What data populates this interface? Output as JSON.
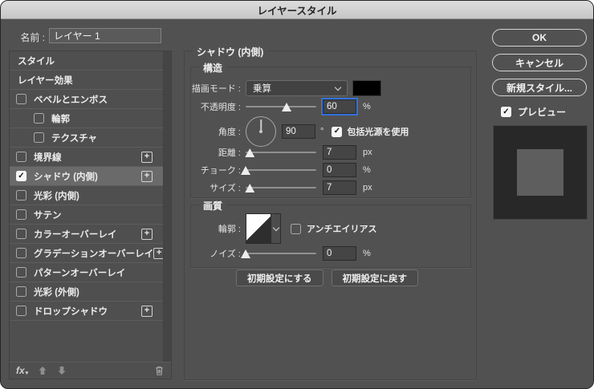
{
  "window": {
    "title": "レイヤースタイル"
  },
  "name_field": {
    "label": "名前 :",
    "value": "レイヤー 1"
  },
  "icons": {
    "plus": "+",
    "check": "✓",
    "caret": "▾"
  },
  "sidebar": {
    "items": [
      {
        "label": "スタイル"
      },
      {
        "label": "レイヤー効果"
      },
      {
        "label": "ベベルとエンボス",
        "checked": false
      },
      {
        "label": "輪郭",
        "checked": false
      },
      {
        "label": "テクスチャ",
        "checked": false
      },
      {
        "label": "境界線",
        "checked": false,
        "plus": true
      },
      {
        "label": "シャドウ (内側)",
        "checked": true,
        "plus": true,
        "selected": true
      },
      {
        "label": "光彩 (内側)",
        "checked": false
      },
      {
        "label": "サテン",
        "checked": false
      },
      {
        "label": "カラーオーバーレイ",
        "checked": false,
        "plus": true
      },
      {
        "label": "グラデーションオーバーレイ",
        "checked": false,
        "plus": true
      },
      {
        "label": "パターンオーバーレイ",
        "checked": false
      },
      {
        "label": "光彩 (外側)",
        "checked": false
      },
      {
        "label": "ドロップシャドウ",
        "checked": false,
        "plus": true
      }
    ],
    "footer": {
      "fx": "fx"
    }
  },
  "panel": {
    "title": "シャドウ (内側)",
    "structure": {
      "legend": "構造",
      "blend_mode": {
        "label": "描画モード :",
        "value": "乗算"
      },
      "opacity": {
        "label": "不透明度 :",
        "value": "60",
        "unit": "%",
        "pct": 58
      },
      "angle": {
        "label": "角度 :",
        "value": "90",
        "unit": "°",
        "use_global": "包括光源を使用",
        "checked": true
      },
      "distance": {
        "label": "距離 :",
        "value": "7",
        "unit": "px",
        "pct": 6
      },
      "choke": {
        "label": "チョーク :",
        "value": "0",
        "unit": "%",
        "pct": 0
      },
      "size": {
        "label": "サイズ :",
        "value": "7",
        "unit": "px",
        "pct": 6
      }
    },
    "quality": {
      "legend": "画質",
      "contour_label": "輪郭 :",
      "anti_alias": "アンチエイリアス",
      "noise": {
        "label": "ノイズ :",
        "value": "0",
        "unit": "%",
        "pct": 0
      }
    },
    "defaults": {
      "set": "初期設定にする",
      "reset": "初期設定に戻す"
    }
  },
  "actions": {
    "ok": "OK",
    "cancel": "キャンセル",
    "new_style": "新規スタイル...",
    "preview": "プレビュー"
  },
  "colors": {
    "focus_ring": "#3273de",
    "blend_swatch": "#000000",
    "preview_bg": "#282828",
    "preview_square": "#5e5e5e"
  }
}
